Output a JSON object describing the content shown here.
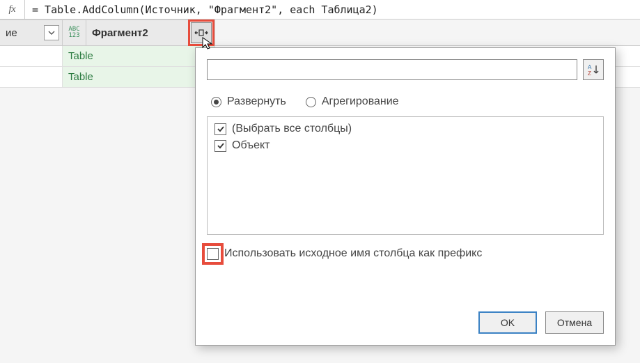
{
  "formula": {
    "fx_label": "fx",
    "text": "= Table.AddColumn(Источник, \"Фрагмент2\", each Таблица2)"
  },
  "columns": {
    "col1_partial_label": "ие",
    "col2_type_top": "ABC",
    "col2_type_bottom": "123",
    "col2_label": "Фрагмент2"
  },
  "rows": {
    "cell_link": "Table"
  },
  "popup": {
    "search_placeholder": "",
    "radio_expand": "Развернуть",
    "radio_aggregate": "Агрегирование",
    "select_all": "(Выбрать все столбцы)",
    "col_object": "Объект",
    "prefix_label": "Использовать исходное имя столбца как префикс",
    "ok": "OK",
    "cancel": "Отмена"
  }
}
